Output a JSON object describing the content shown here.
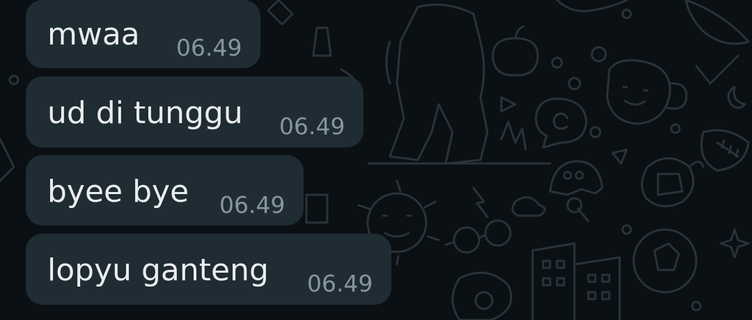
{
  "chat": {
    "messages": [
      {
        "text": "mwaa",
        "time": "06.49"
      },
      {
        "text": "ud di tunggu",
        "time": "06.49"
      },
      {
        "text": "byee bye",
        "time": "06.49"
      },
      {
        "text": "lopyu ganteng",
        "time": "06.49"
      }
    ]
  },
  "colors": {
    "background": "#0b1014",
    "bubble": "#202c33",
    "message_text": "#e9edef",
    "timestamp_text": "#8696a0",
    "doodle": "#2a3338"
  }
}
